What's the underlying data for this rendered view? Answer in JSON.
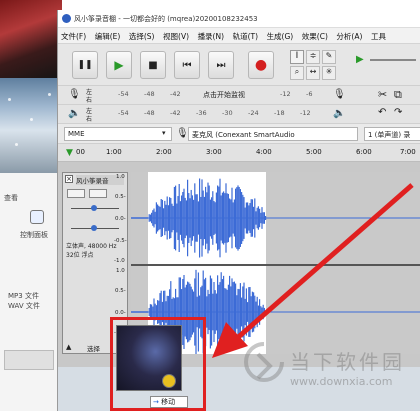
{
  "background_window": {
    "labels": [
      "查看",
      "控制面板",
      "MP3 文件",
      "WAV 文件"
    ]
  },
  "window": {
    "title": "风小筝录音棚 - 一切都会好的 (mqrea)20200108232453"
  },
  "menu": [
    "文件(F)",
    "编辑(E)",
    "选择(S)",
    "视图(V)",
    "播录(N)",
    "轨道(T)",
    "生成(G)",
    "效果(C)",
    "分析(A)",
    "工具"
  ],
  "transport": [
    {
      "name": "pause-button",
      "glyph": "❚❚"
    },
    {
      "name": "play-button",
      "glyph": "▶"
    },
    {
      "name": "stop-button",
      "glyph": "■"
    },
    {
      "name": "skip-start-button",
      "glyph": "⏮"
    },
    {
      "name": "skip-end-button",
      "glyph": "⏭"
    },
    {
      "name": "record-button",
      "glyph": "●"
    }
  ],
  "meters": {
    "record": {
      "channel_l": "左",
      "channel_r": "右",
      "hint": "点击开始监视"
    },
    "play": {
      "channel_l": "左",
      "channel_r": "右"
    },
    "scale": [
      "-54",
      "-48",
      "-42",
      "-36",
      "-30",
      "-24",
      "-18",
      "-12",
      "-6"
    ]
  },
  "devices": {
    "host": "MME",
    "input": "麦克风 (Conexant SmartAudio",
    "channels": "1 (单声道) 录"
  },
  "ruler": {
    "ticks": [
      "00",
      "1:00",
      "2:00",
      "3:00",
      "4:00",
      "5:00",
      "6:00",
      "7:00"
    ]
  },
  "track": {
    "name": "风小筝录音",
    "info_line1": "立体声, 48000 Hz",
    "info_line2": "32位 浮点",
    "scale_top": [
      "1.0",
      "0.5-",
      "0.0-",
      "-0.5-",
      "-1.0"
    ],
    "select_label": "选择"
  },
  "drag": {
    "tip": "移动"
  },
  "watermark": {
    "cn": "当下软件园",
    "url": "www.downxia.com"
  },
  "colors": {
    "waveform": "#3c6bd6",
    "selection": "#ffffff",
    "highlight": "#e02020"
  }
}
